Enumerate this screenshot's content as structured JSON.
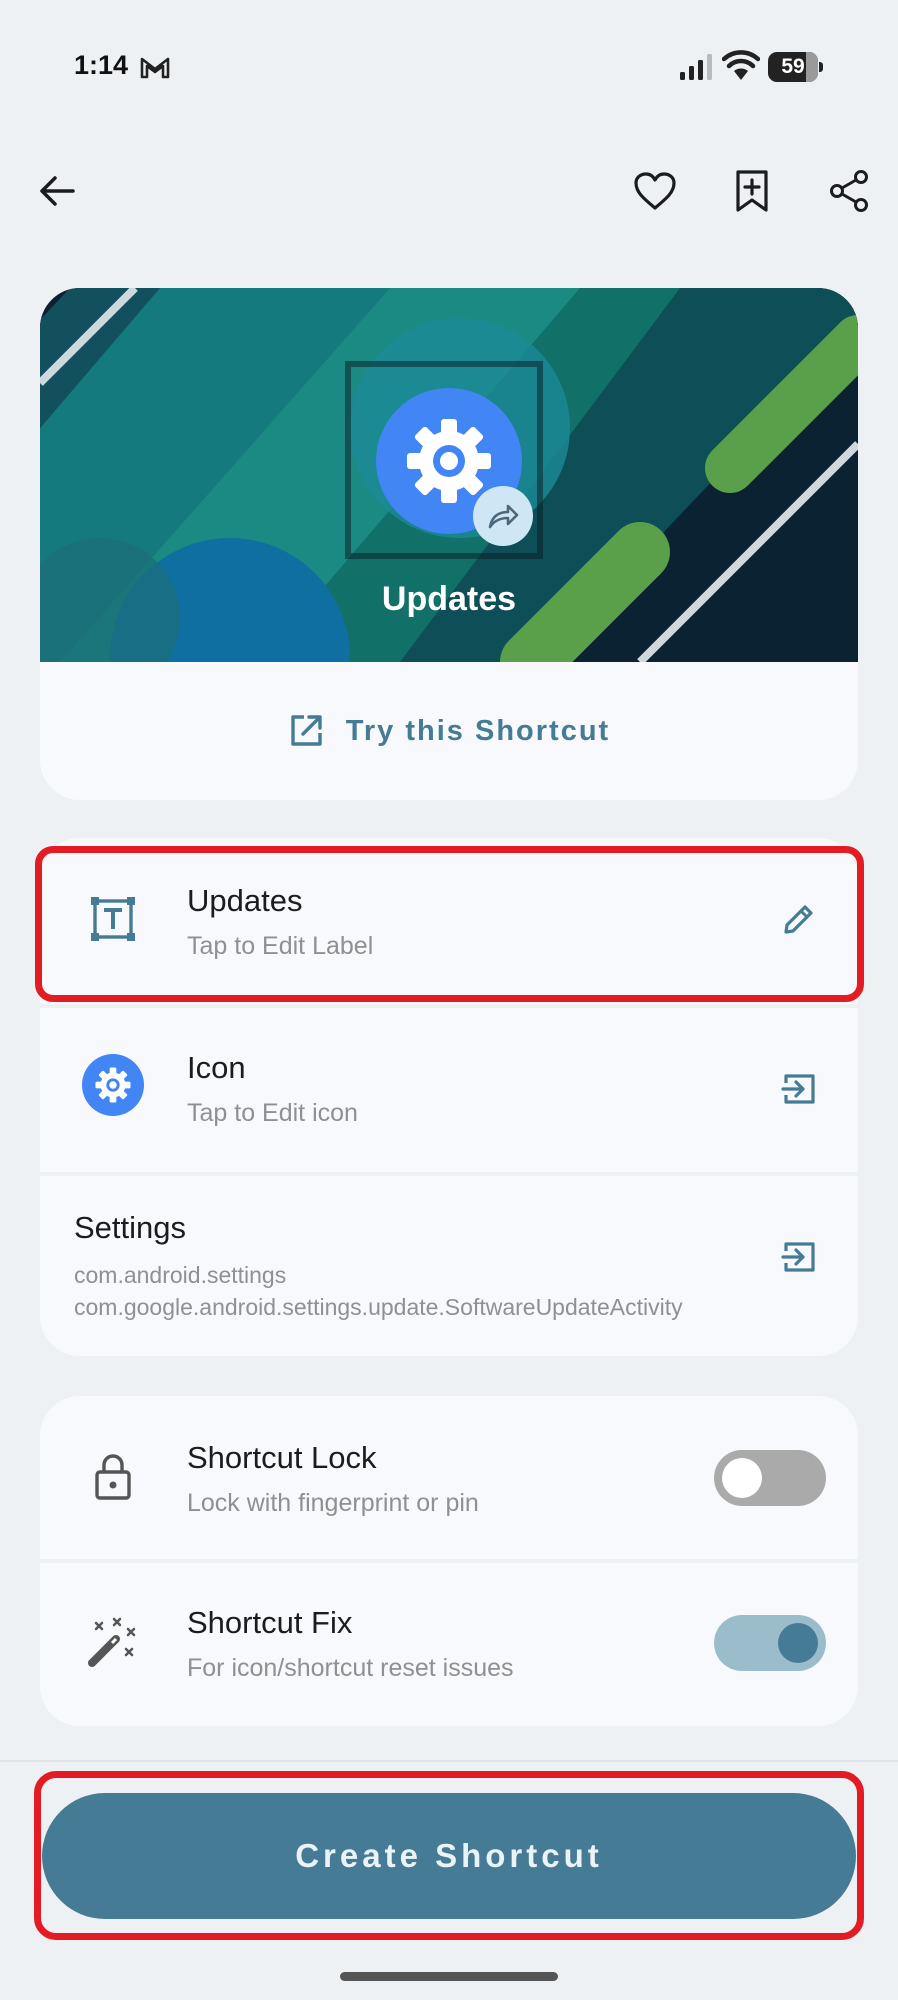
{
  "status_bar": {
    "time": "1:14",
    "battery": "59"
  },
  "toolbar": {
    "back_icon": "arrow-left-icon",
    "favorite_icon": "heart-icon",
    "bookmark_icon": "bookmark-add-icon",
    "share_icon": "share-icon"
  },
  "hero": {
    "title": "Updates",
    "try_label": "Try this Shortcut"
  },
  "details": {
    "label_row": {
      "title": "Updates",
      "subtitle": "Tap to Edit Label"
    },
    "icon_row": {
      "title": "Icon",
      "subtitle": "Tap to Edit icon"
    },
    "target_row": {
      "title": "Settings",
      "package": "com.android.settings",
      "activity": "com.google.android.settings.update.SoftwareUpdateActivity"
    }
  },
  "options": {
    "lock": {
      "title": "Shortcut Lock",
      "subtitle": "Lock with fingerprint or pin",
      "enabled": false
    },
    "fix": {
      "title": "Shortcut Fix",
      "subtitle": "For icon/shortcut reset issues",
      "enabled": true
    }
  },
  "create_button": "Create Shortcut",
  "colors": {
    "accent": "#467b95",
    "highlight": "#e31b23",
    "app_icon": "#4285f4"
  }
}
